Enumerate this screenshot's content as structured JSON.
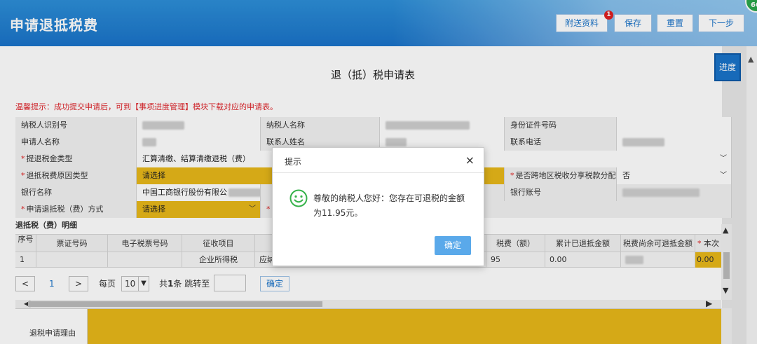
{
  "header": {
    "title": "申请退抵税费",
    "buttons": {
      "attach": "附送资料",
      "attach_badge": "1",
      "save": "保存",
      "reset": "重置",
      "next": "下一步"
    },
    "corner": "66"
  },
  "page": {
    "form_title": "退（抵）税申请表",
    "tip": "温馨提示：成功提交申请后，可到【事项进度管理】模块下载对应的申请表。",
    "progress_button": "进度"
  },
  "form": {
    "taxpayer_id_label": "纳税人识别号",
    "taxpayer_name_label": "纳税人名称",
    "id_number_label": "身份证件号码",
    "applicant_label": "申请人名称",
    "contact_label": "联系人姓名",
    "phone_label": "联系电话",
    "refund_type_label": "提退税金类型",
    "refund_type_value": "汇算清缴、结算清缴退税（费）",
    "reason_type_label": "退抵税费原因类型",
    "reason_type_value": "请选择",
    "cross_region_label": "是否跨地区税收分享税款分配",
    "cross_region_value": "否",
    "bank_label": "银行名称",
    "bank_value": "中国工商银行股份有限公",
    "bank_account_label": "银行账号",
    "method_label": "申请退抵税（费）方式",
    "method_value": "请选择"
  },
  "detail": {
    "section_title": "退抵税（费）明细",
    "columns": [
      "序号",
      "票证号码",
      "电子税票号码",
      "征收项目",
      "",
      "税费（额）",
      "累计已退抵金额",
      "税费尚余可退抵金额",
      "本次"
    ],
    "row": {
      "index": "1",
      "item": "企业所得税",
      "col5": "应纳",
      "tax": "95",
      "refunded": "0.00",
      "current": "0.00"
    }
  },
  "pager": {
    "prev": "<",
    "page": "1",
    "next": ">",
    "per_page_label": "每页",
    "per_page_value": "10",
    "total": "共1条 跳转至",
    "total_prefix": "共",
    "total_count": "1",
    "total_suffix": "条 跳转至",
    "confirm": "确定"
  },
  "reason_label": "退税申请理由",
  "dialog": {
    "title": "提示",
    "close": "×",
    "message": "尊敬的纳税人您好：您存在可退税的金额为11.95元。",
    "ok": "确定"
  },
  "colors": {
    "brand": "#1a73c9",
    "highlight": "#e8b81a",
    "warning": "#e0282e"
  }
}
